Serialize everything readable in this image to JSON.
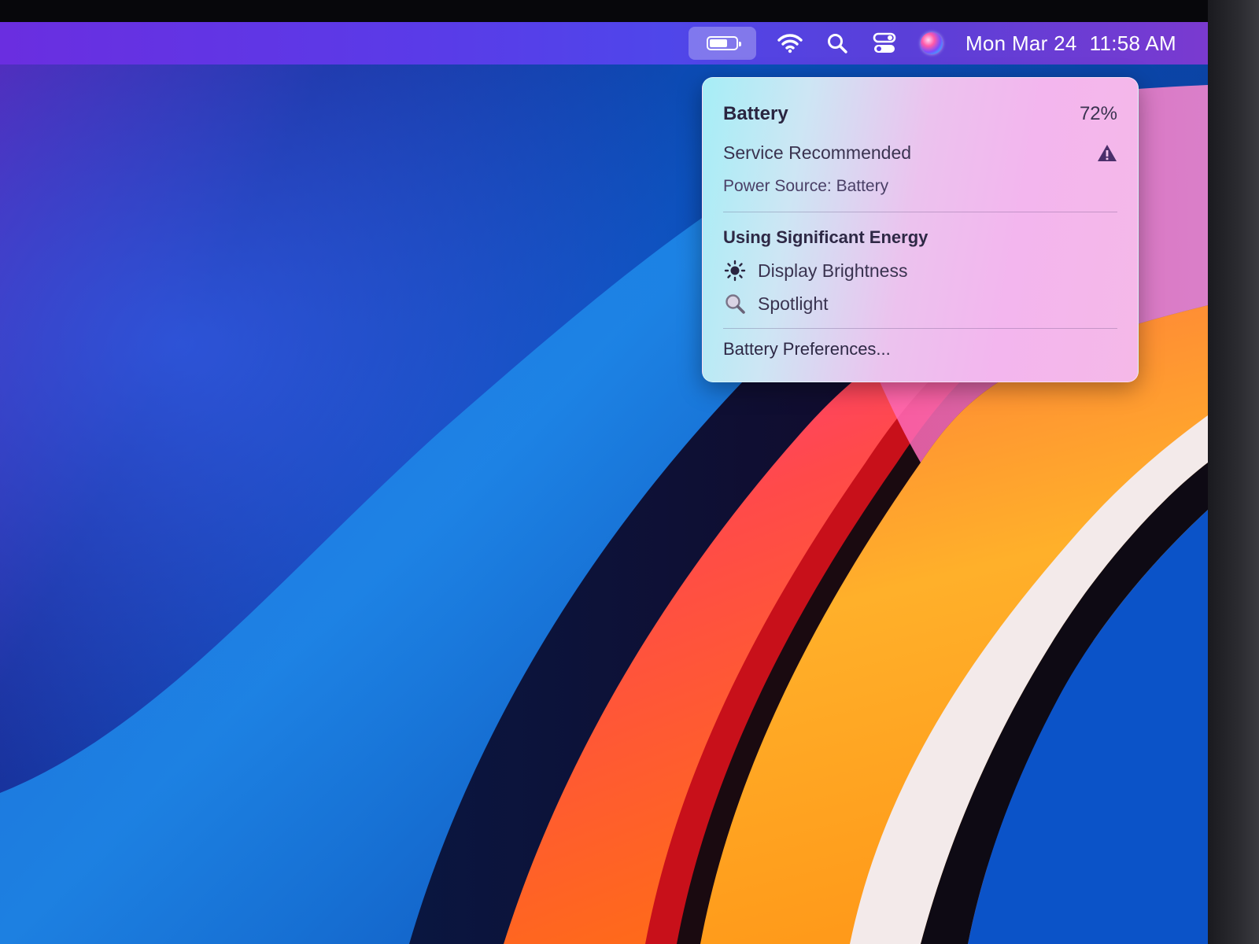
{
  "menubar": {
    "battery_level": 0.72,
    "date": "Mon Mar 24",
    "time": "11:58 AM",
    "icons": [
      "battery-icon",
      "wifi-icon",
      "spotlight-search-icon",
      "control-center-icon",
      "siri-icon"
    ]
  },
  "battery_menu": {
    "title": "Battery",
    "percent": "72%",
    "service": "Service Recommended",
    "power_source": "Power Source: Battery",
    "energy_section": "Using Significant Energy",
    "apps": [
      {
        "label": "Display Brightness",
        "icon": "sun-icon"
      },
      {
        "label": "Spotlight",
        "icon": "magnifier-icon"
      }
    ],
    "preferences": "Battery Preferences..."
  },
  "colors": {
    "menubar_accent": "#5a3be8",
    "warning": "#4a2f6a"
  }
}
